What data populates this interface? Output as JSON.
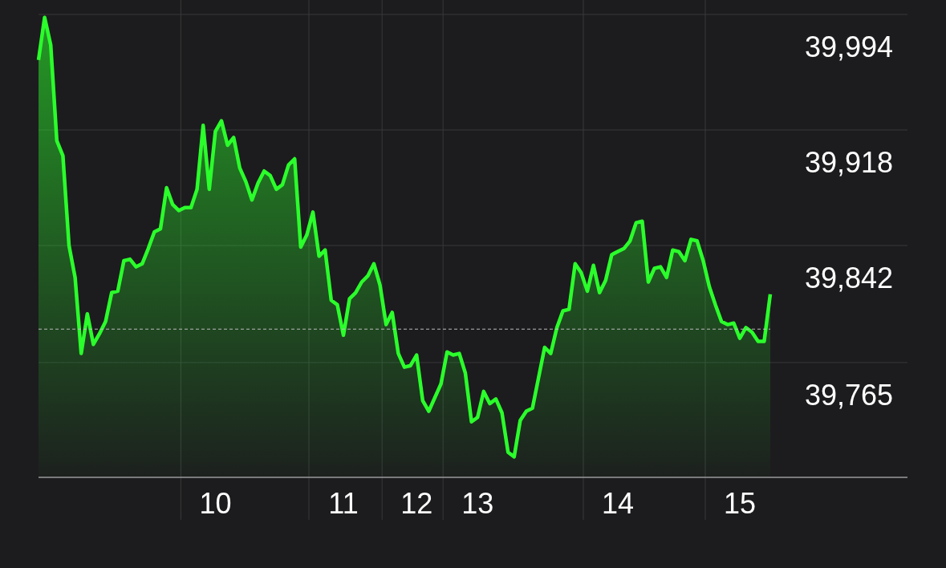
{
  "chart": {
    "chart_data": {
      "type": "area",
      "categories": [
        null,
        null,
        null,
        null,
        null,
        null,
        null,
        null,
        null,
        null,
        null,
        null,
        null,
        null,
        null,
        null,
        null,
        null,
        null,
        null,
        null,
        null,
        null,
        null,
        null,
        null,
        null,
        null,
        null,
        "10",
        null,
        null,
        null,
        null,
        null,
        null,
        null,
        null,
        null,
        null,
        null,
        null,
        null,
        null,
        null,
        null,
        null,
        null,
        null,
        null,
        "11",
        null,
        null,
        null,
        null,
        null,
        null,
        null,
        null,
        null,
        null,
        null,
        "12",
        null,
        null,
        null,
        null,
        null,
        null,
        null,
        null,
        null,
        "13",
        null,
        null,
        null,
        null,
        null,
        null,
        null,
        null,
        null,
        null,
        null,
        null,
        null,
        null,
        null,
        null,
        null,
        null,
        null,
        null,
        null,
        null,
        "14",
        null,
        null,
        null,
        null,
        null,
        null,
        null,
        null,
        null,
        null,
        null,
        null,
        null,
        null,
        null,
        null,
        null,
        null,
        null,
        "15",
        null,
        null,
        null,
        null,
        null
      ],
      "grid": true,
      "series": [
        {
          "color": "#2bff2b",
          "values": [
            39964,
            39992,
            39974,
            39911,
            39901,
            39842,
            39821,
            39771,
            39797,
            39777,
            39784,
            39792,
            39811,
            39812,
            39832,
            39833,
            39828,
            39830,
            39840,
            39851,
            39853,
            39880,
            39869,
            39865,
            39867,
            39867,
            39879,
            39921,
            39879,
            39917,
            39924,
            39908,
            39913,
            39893,
            39884,
            39872,
            39883,
            39891,
            39888,
            39879,
            39882,
            39895,
            39899,
            39841,
            39849,
            39864,
            39835,
            39839,
            39806,
            39803,
            39783,
            39807,
            39811,
            39818,
            39822,
            39830,
            39816,
            39790,
            39798,
            39771,
            39762,
            39763,
            39770,
            39740,
            39733,
            39742,
            39751,
            39772,
            39770,
            39771,
            39758,
            39726,
            39729,
            39746,
            39738,
            39741,
            39732,
            39706,
            39703,
            39727,
            39733,
            39735,
            39755,
            39775,
            39771,
            39788,
            39799,
            39800,
            39830,
            39824,
            39812,
            39829,
            39811,
            39819,
            39836,
            39838,
            39840,
            39845,
            39857,
            39858,
            39818,
            39827,
            39828,
            39821,
            39839,
            39838,
            39832,
            39846,
            39845,
            39832,
            39815,
            39803,
            39792,
            39790,
            39791,
            39781,
            39788,
            39785,
            39779,
            39779,
            39810
          ]
        }
      ],
      "ylim": [
        39689.5,
        40003.5
      ],
      "yticks": [
        {
          "value": 39994,
          "label": "39,994"
        },
        {
          "value": 39918,
          "label": "39,918"
        },
        {
          "value": 39842,
          "label": "39,842"
        },
        {
          "value": 39765,
          "label": "39,765"
        }
      ],
      "ref_lines": [
        {
          "axis": "y",
          "value": 39787
        }
      ]
    }
  }
}
